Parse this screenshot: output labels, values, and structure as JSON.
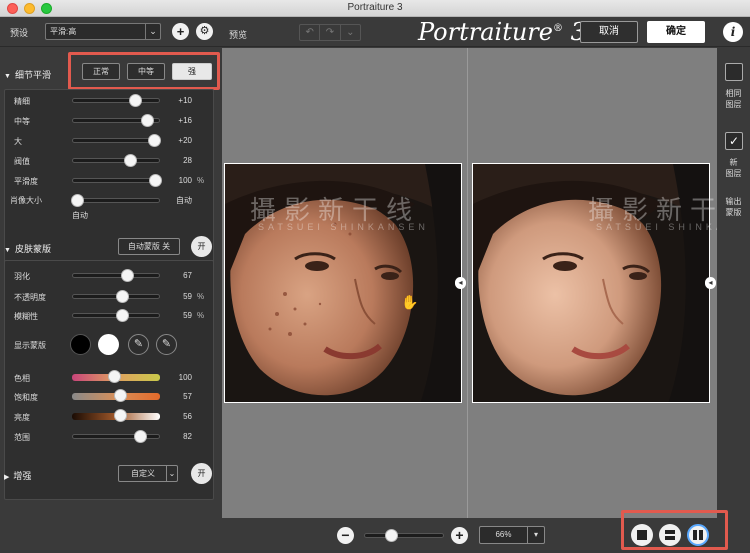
{
  "window": {
    "title": "Portraiture 3"
  },
  "toolbar": {
    "preset_label": "预设",
    "preset_value": "平滑:高",
    "preview_label": "预览",
    "logo_text": "Portraiture",
    "logo_mark": "®",
    "logo_version": "3",
    "cancel_label": "取消",
    "ok_label": "确定",
    "info_label": "i"
  },
  "detail_smoothing": {
    "title": "细节平滑",
    "modes": [
      {
        "label": "正常",
        "active": false
      },
      {
        "label": "中等",
        "active": false
      },
      {
        "label": "强",
        "active": true
      }
    ],
    "sliders": [
      {
        "label": "精细",
        "value": "+10",
        "unit": "",
        "position": 0.72
      },
      {
        "label": "中等",
        "value": "+16",
        "unit": "",
        "position": 0.86
      },
      {
        "label": "大",
        "value": "+20",
        "unit": "",
        "position": 0.94
      },
      {
        "label": "阀值",
        "value": "28",
        "unit": "",
        "position": 0.66
      },
      {
        "label": "平滑度",
        "value": "100",
        "unit": "%",
        "position": 0.95
      }
    ],
    "portrait_size": {
      "label": "肖像大小",
      "value": "自动",
      "sub": "自动",
      "position": 0.05
    }
  },
  "skin_mask": {
    "title": "皮肤蒙版",
    "auto_mask_label": "自动蒙版 关",
    "toggle_label": "开",
    "sliders": [
      {
        "label": "羽化",
        "value": "67",
        "unit": "",
        "position": 0.63
      },
      {
        "label": "不透明度",
        "value": "59",
        "unit": "%",
        "position": 0.57
      },
      {
        "label": "模糊性",
        "value": "59",
        "unit": "%",
        "position": 0.57
      }
    ],
    "show_mask_label": "显示蒙版",
    "color_sliders": [
      {
        "label": "色相",
        "value": "100",
        "position": 0.48
      },
      {
        "label": "饱和度",
        "value": "57",
        "position": 0.55
      },
      {
        "label": "亮度",
        "value": "56",
        "position": 0.55
      },
      {
        "label": "范围",
        "value": "82",
        "position": 0.78
      }
    ]
  },
  "enhance": {
    "title": "增强",
    "preset_value": "自定义",
    "toggle_label": "开"
  },
  "right_panel": {
    "same_layer": "相同\n图层",
    "new_layer": "新\n图层",
    "output_mask": "输出\n蒙版"
  },
  "watermark": {
    "main": "攝影新干线",
    "sub": "SATSUEI SHINKANSEN"
  },
  "bottom": {
    "zoom_value": "66%",
    "zoom_position": 0.33
  },
  "colors": {
    "accent_red": "#e25a4e",
    "canvas_gray": "#7f7f7f",
    "panel": "#3a3a3a"
  }
}
